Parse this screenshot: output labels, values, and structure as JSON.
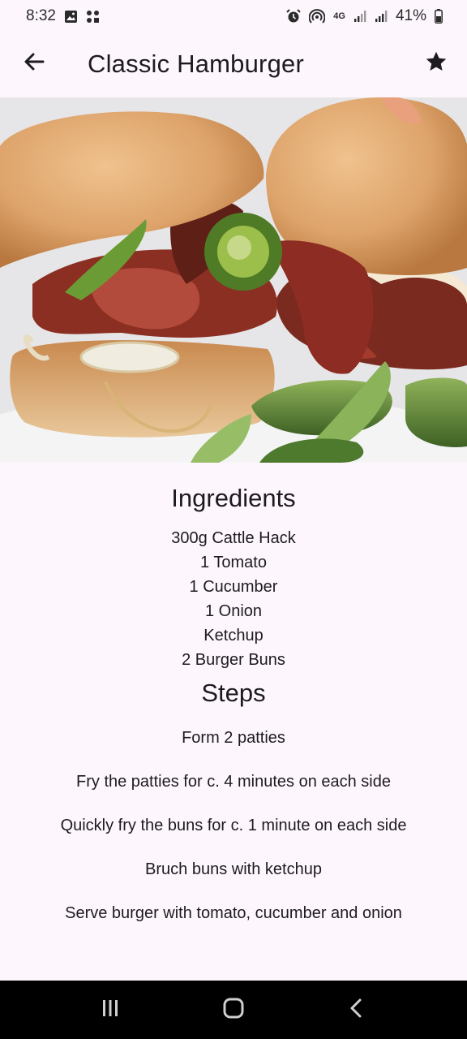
{
  "status_bar": {
    "time": "8:32",
    "network": "4G",
    "battery": "41%"
  },
  "app_bar": {
    "title": "Classic Hamburger",
    "back_icon": "arrow-back-icon",
    "favorite_icon": "star-icon"
  },
  "hero": {
    "image_subject": "hamburger photo"
  },
  "ingredients": {
    "title": "Ingredients",
    "items": [
      "300g Cattle Hack",
      "1 Tomato",
      "1 Cucumber",
      "1 Onion",
      "Ketchup",
      "2 Burger Buns"
    ]
  },
  "steps": {
    "title": "Steps",
    "items": [
      "Form 2 patties",
      "Fry the patties for c. 4 minutes on each side",
      "Quickly fry the buns for c. 1 minute on each side",
      "Bruch buns with ketchup",
      "Serve burger with tomato, cucumber and onion"
    ]
  },
  "nav_bar": {
    "recents_icon": "recents-icon",
    "home_icon": "home-icon",
    "back_icon": "nav-back-icon"
  },
  "colors": {
    "background": "#fdf7fd",
    "text": "#1d1b20",
    "nav_bar": "#000000"
  }
}
